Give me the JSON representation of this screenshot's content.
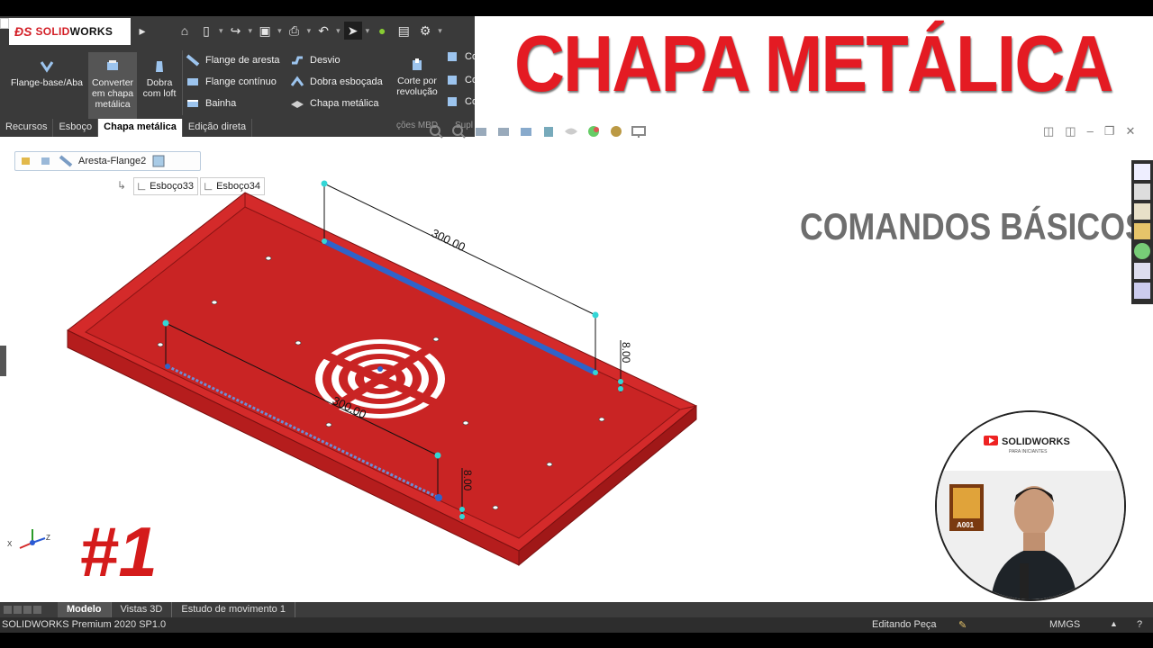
{
  "app": {
    "logo_text_a": "SOLID",
    "logo_text_b": "WORKS",
    "status": {
      "product": "SOLIDWORKS Premium 2020 SP1.0",
      "mode": "Editando Peça",
      "units": "MMGS"
    }
  },
  "ribbon": {
    "big_tools": [
      {
        "label_lines": [
          "Flange-base/Aba"
        ],
        "icon": "base-flange-icon"
      },
      {
        "label_lines": [
          "Converter",
          "em chapa",
          "metálica"
        ],
        "icon": "convert-sheet-icon"
      },
      {
        "label_lines": [
          "Dobra",
          "com loft"
        ],
        "icon": "lofted-bend-icon"
      }
    ],
    "col1": [
      "Flange de aresta",
      "Flange contínuo",
      "Bainha"
    ],
    "col2": [
      "Desvio",
      "Dobra esboçada",
      "Chapa metálica"
    ],
    "revolve_cut": [
      "Corte por",
      "revolução"
    ],
    "partial_labels": [
      "Co",
      "Co",
      "Co"
    ]
  },
  "tabs": [
    {
      "label": "Recursos",
      "active": false
    },
    {
      "label": "Esboço",
      "active": false
    },
    {
      "label": "Chapa metálica",
      "active": true
    },
    {
      "label": "Edição direta",
      "active": false
    }
  ],
  "hidden_tab_fragments": [
    "ções MBD",
    "Supl"
  ],
  "breadcrumb": {
    "feature": "Aresta-Flange2"
  },
  "sketches": [
    "Esboço33",
    "Esboço34"
  ],
  "overlay": {
    "title": "CHAPA METÁLICA",
    "subtitle": "COMANDOS BÁSICOS",
    "episode": "#1"
  },
  "dimensions": {
    "top_length": "300.00",
    "front_length": "300.00",
    "top_height": "8.00",
    "front_height": "8.00"
  },
  "triad": {
    "x": "X",
    "z": "Z"
  },
  "bottom_tabs": [
    {
      "label": "Modelo",
      "active": true
    },
    {
      "label": "Vistas 3D",
      "active": false
    },
    {
      "label": "Estudo de movimento 1",
      "active": false
    }
  ],
  "channel": {
    "name": "SOLIDWORKS",
    "tagline": "PARA INICIANTES",
    "poster_text": "A001"
  },
  "colors": {
    "part_red": "#d42a2a",
    "title_red": "#e41b23",
    "ribbon_bg": "#3a3a3a",
    "selection_blue": "#2f63c9"
  }
}
